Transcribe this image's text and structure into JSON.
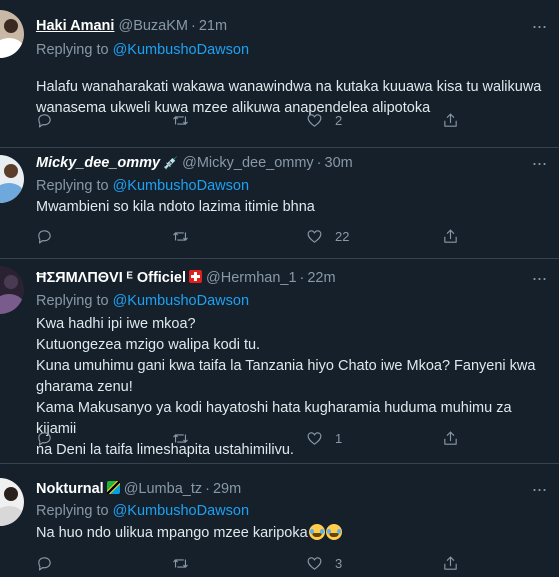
{
  "tweets": [
    {
      "name": "Haki Amani",
      "handle": "@BuzaKM",
      "time": "21m",
      "replying_prefix": "Replying to ",
      "replying_to": "@KumbushoDawson",
      "text": "Halafu wanaharakati wakawa wanawindwa na kutaka kuuawa kisa tu walikuwa\nwanasema ukweli kuwa mzee alikuwa anapendelea alipotoka",
      "likes": "2",
      "avatar_colors": {
        "face": "#3b2a22",
        "body": "#ffffff",
        "bg": "#c9b8a6"
      }
    },
    {
      "name": "Micky_dee_ommy",
      "handle": "@Micky_dee_ommy",
      "time": "30m",
      "replying_prefix": "Replying to ",
      "replying_to": "@KumbushoDawson",
      "text": "Mwambieni so kila ndoto lazima itimie bhna",
      "likes": "22",
      "avatar_colors": {
        "face": "#5a3e2b",
        "body": "#6fa8dc",
        "bg": "#e8eef2"
      }
    },
    {
      "name": "ĦΣЯMΛПΘVI ᴱ Officiel",
      "handle": "@Hermhan_1",
      "time": "22m",
      "replying_prefix": "Replying to ",
      "replying_to": "@KumbushoDawson",
      "text": "Kwa hadhi ipi iwe mkoa?\nKutuongezea mzigo walipa kodi tu.\nKuna umuhimu gani kwa taifa la Tanzania hiyo Chato iwe Mkoa? Fanyeni kwa\ngharama zenu!\nKama Makusanyo ya kodi hayatoshi hata kugharamia huduma muhimu za kijamii\nna Deni la taifa limeshapita ustahimilivu.",
      "likes": "1",
      "avatar_colors": {
        "face": "#4a3b52",
        "body": "#7a5c8c",
        "bg": "#2a2233"
      }
    },
    {
      "name": "Nokturnal",
      "handle": "@Lumba_tz",
      "time": "29m",
      "replying_prefix": "Replying to ",
      "replying_to": "@KumbushoDawson",
      "text": "Na huo ndo ulikua mpango mzee karipoka",
      "likes": "3",
      "avatar_colors": {
        "face": "#2b211c",
        "body": "#d8d8d8",
        "bg": "#f0f0f0"
      }
    }
  ],
  "icons": {
    "reply": "reply-icon",
    "retweet": "retweet-icon",
    "like": "heart-icon",
    "share": "share-icon",
    "more": "more-icon"
  },
  "colors": {
    "background": "#15202b",
    "accent": "#1da1f2",
    "muted": "#8899a6",
    "divider": "#38444d"
  }
}
